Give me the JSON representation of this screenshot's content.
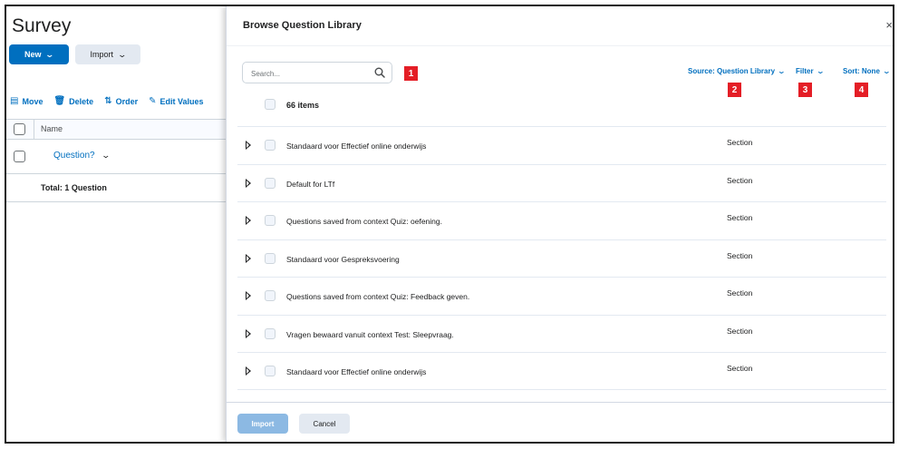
{
  "background": {
    "title": "Survey",
    "new_label": "New",
    "import_label": "Import",
    "toolbar": {
      "move": "Move",
      "delete": "Delete",
      "order": "Order",
      "edit_values": "Edit Values"
    },
    "table": {
      "header_name": "Name",
      "question_label": "Question?",
      "total": "Total: 1 Question"
    }
  },
  "dialog": {
    "title": "Browse Question Library",
    "close": "×",
    "search_placeholder": "Search...",
    "source_label": "Source: Question Library",
    "filter_label": "Filter",
    "sort_label": "Sort: None",
    "items_count": "66 items",
    "rows": [
      {
        "title": "Standaard voor Effectief online onderwijs",
        "type": "Section"
      },
      {
        "title": "Default for LTf",
        "type": "Section"
      },
      {
        "title": "Questions saved from context Quiz: oefening.",
        "type": "Section"
      },
      {
        "title": "Standaard voor Gespreksvoering",
        "type": "Section"
      },
      {
        "title": "Questions saved from context Quiz: Feedback geven.",
        "type": "Section"
      },
      {
        "title": "Vragen bewaard vanuit context Test: Sleepvraag.",
        "type": "Section"
      },
      {
        "title": "Standaard voor Effectief online onderwijs",
        "type": "Section"
      }
    ],
    "import_button": "Import",
    "cancel_button": "Cancel"
  },
  "annotations": [
    "1",
    "2",
    "3",
    "4"
  ],
  "colors": {
    "primary": "#006fbf",
    "primary_disabled": "#8cb9e3",
    "badge": "#e41e26",
    "secondary_button": "#e3e9f1"
  }
}
